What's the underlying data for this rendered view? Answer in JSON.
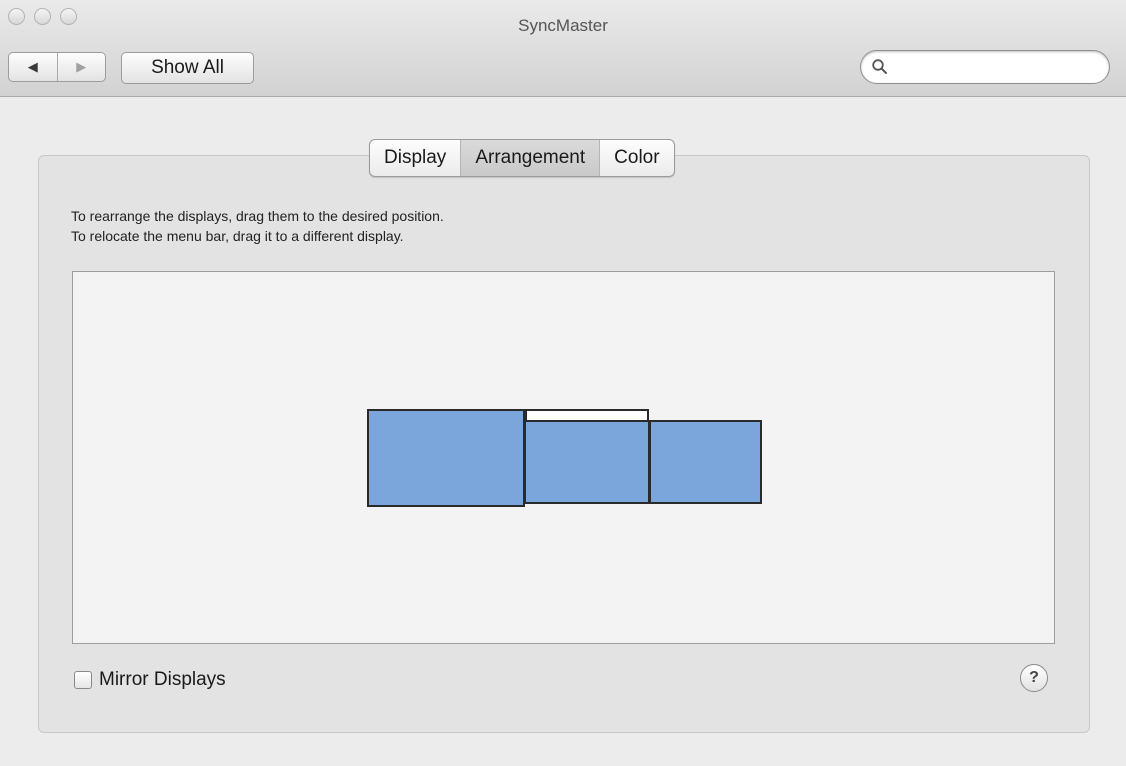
{
  "window": {
    "title": "SyncMaster"
  },
  "toolbar": {
    "back_icon": "back-arrow-icon",
    "forward_icon": "forward-arrow-icon",
    "show_all_label": "Show All",
    "search_value": "",
    "search_icon": "magnifier-icon"
  },
  "tabs": [
    {
      "label": "Display",
      "selected": false
    },
    {
      "label": "Arrangement",
      "selected": true
    },
    {
      "label": "Color",
      "selected": false
    }
  ],
  "instructions": [
    "To rearrange the displays, drag them to the desired position.",
    "To relocate the menu bar, drag it to a different display."
  ],
  "arrangement": {
    "display_count": 3,
    "display_color": "#7ba6dc",
    "menu_bar_on": "display 2"
  },
  "mirror": {
    "label": "Mirror Displays",
    "checked": false
  },
  "help": {
    "label": "?"
  }
}
